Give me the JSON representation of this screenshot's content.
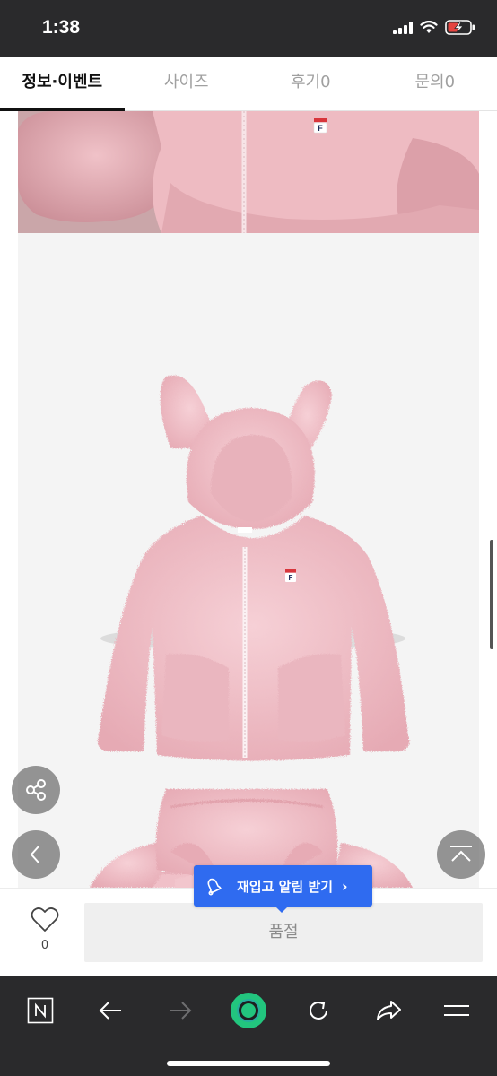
{
  "status_bar": {
    "time": "1:38"
  },
  "tabs": [
    {
      "label": "정보·이벤트"
    },
    {
      "label": "사이즈"
    },
    {
      "label": "후기0"
    },
    {
      "label": "문의0"
    }
  ],
  "product": {
    "brand_mark": "F"
  },
  "restock": {
    "label": "재입고 알림 받기"
  },
  "action_bar": {
    "like_count": "0",
    "soldout_label": "품절"
  },
  "colors": {
    "accent_blue": "#2f6bf0",
    "jacket_pink": "#f1c4cb",
    "brand_red": "#d8353b",
    "brand_navy": "#1a2a5a",
    "loading_green": "#22c57e"
  },
  "icons": [
    "signal-icon",
    "wifi-icon",
    "battery-charging-icon",
    "share-icon",
    "back-chevron-icon",
    "scroll-top-icon",
    "bell-icon",
    "heart-icon",
    "n-logo-icon",
    "back-arrow-icon",
    "forward-arrow-icon",
    "loading-indicator-icon",
    "reload-icon",
    "share-arrow-icon",
    "menu-icon"
  ]
}
